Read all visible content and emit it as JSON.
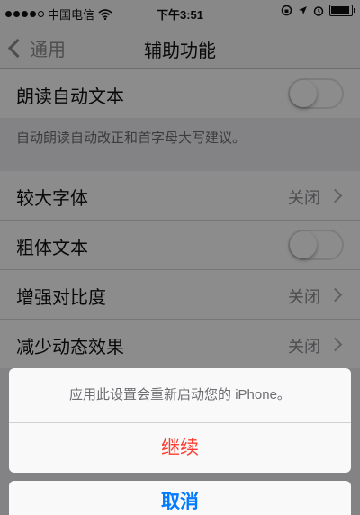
{
  "status_bar": {
    "carrier": "中国电信",
    "time": "下午3:51",
    "signal_bars": 5,
    "signal_filled": 4
  },
  "nav": {
    "back_label": "通用",
    "title": "辅助功能"
  },
  "settings": {
    "speak_auto_text": {
      "label": "朗读自动文本",
      "enabled": false
    },
    "speak_auto_text_note": "自动朗读自动改正和首字母大写建议。",
    "larger_text": {
      "label": "较大字体",
      "value": "关闭"
    },
    "bold_text": {
      "label": "粗体文本",
      "enabled": false
    },
    "increase_contrast": {
      "label": "增强对比度",
      "value": "关闭"
    },
    "reduce_motion": {
      "label": "减少动态效果",
      "value": "关闭"
    }
  },
  "action_sheet": {
    "message": "应用此设置会重新启动您的 iPhone。",
    "continue_label": "继续",
    "cancel_label": "取消"
  },
  "colors": {
    "destructive": "#ff3b30",
    "accent": "#007aff"
  }
}
